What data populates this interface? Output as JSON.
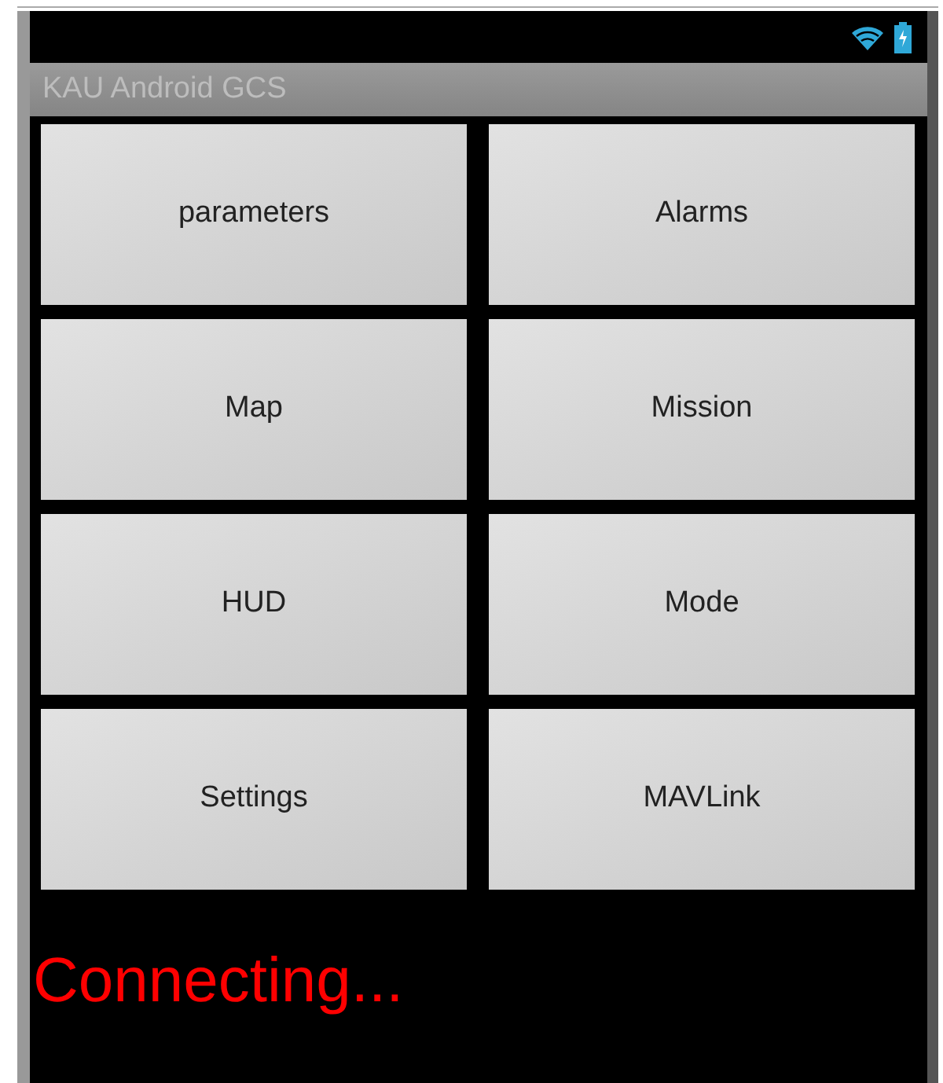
{
  "app_bar": {
    "title": "KAU Android GCS"
  },
  "buttons": [
    "parameters",
    "Alarms",
    "Map",
    "Mission",
    "HUD",
    "Mode",
    "Settings",
    "MAVLink"
  ],
  "status": "Connecting..."
}
